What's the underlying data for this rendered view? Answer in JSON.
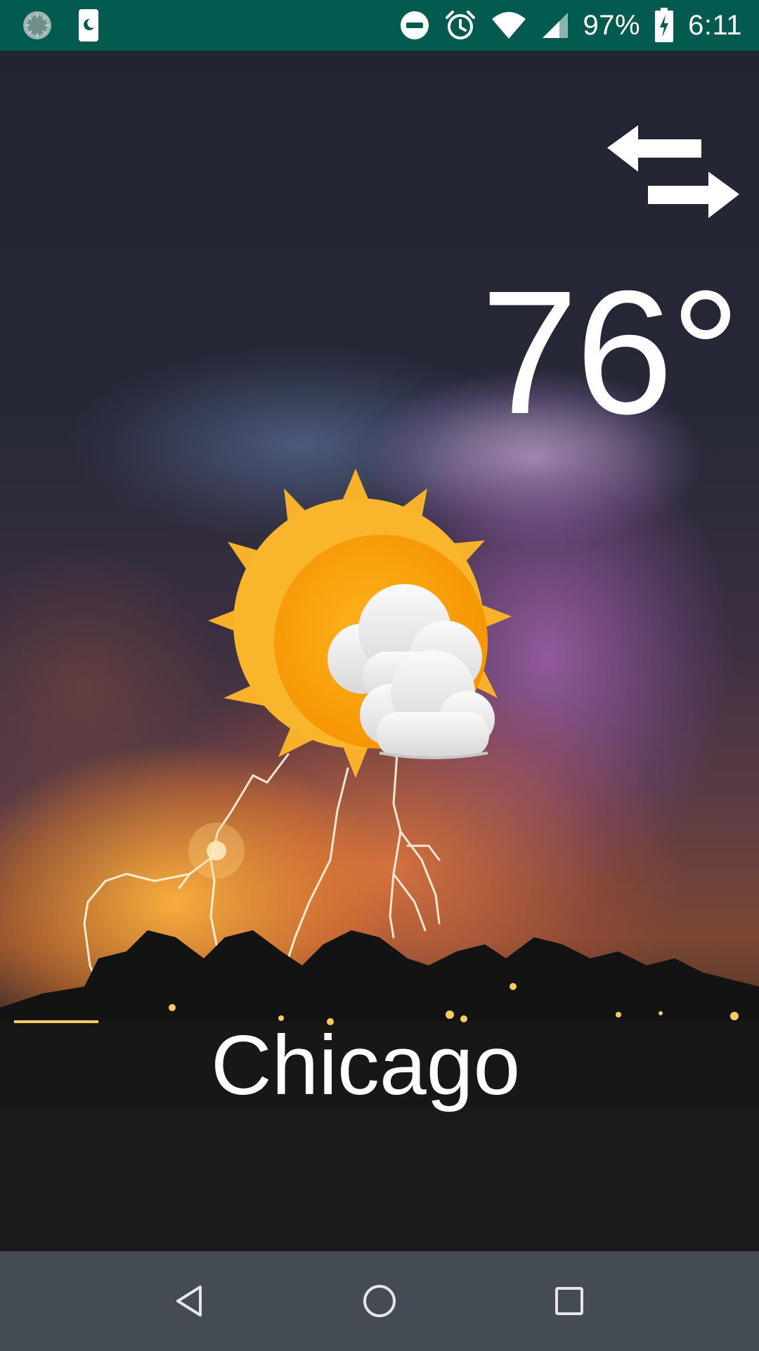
{
  "status_bar": {
    "battery_percent": "97%",
    "time": "6:11",
    "left_icons": [
      "app-notification-icon",
      "night-mode-icon"
    ],
    "right_icons": [
      "do-not-disturb-icon",
      "alarm-icon",
      "wifi-icon",
      "cellular-signal-icon",
      "battery-charging-icon"
    ],
    "background_color": "#035a4f"
  },
  "weather": {
    "temperature": "76°",
    "city": "Chicago",
    "condition_icon": "partly-cloudy-icon",
    "toggle_icon": "swap-arrows-icon",
    "background": "lightning-storm-photo"
  },
  "nav_bar": {
    "buttons": [
      "back-icon",
      "home-icon",
      "recents-icon"
    ],
    "background_color": "#454b52"
  },
  "colors": {
    "sun": "#f9a825",
    "sun_core": "#ffa000",
    "cloud": "#ececec",
    "text": "#ffffff"
  }
}
